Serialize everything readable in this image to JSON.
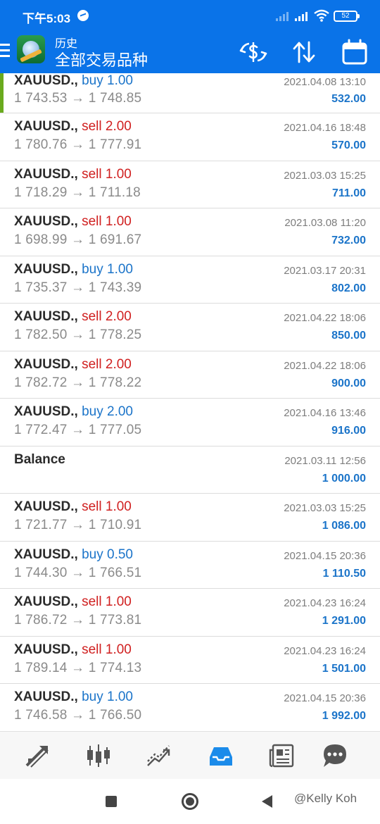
{
  "status_bar": {
    "time": "下午5:03",
    "battery": "52"
  },
  "app_bar": {
    "title_small": "历史",
    "title_large": "全部交易品种",
    "accent_color": "#0a73e8",
    "icons": [
      "menu-icon",
      "app-logo-icon",
      "currency-swap-icon",
      "sort-icon",
      "calendar-icon"
    ]
  },
  "trades": [
    {
      "symbol": "XAUUSD.,",
      "side": "buy",
      "volume": "1.00",
      "open": "1 743.53",
      "close": "1 748.85",
      "date": "2021.04.08 13:10",
      "amount": "532.00"
    },
    {
      "symbol": "XAUUSD.,",
      "side": "sell",
      "volume": "2.00",
      "open": "1 780.76",
      "close": "1 777.91",
      "date": "2021.04.16 18:48",
      "amount": "570.00"
    },
    {
      "symbol": "XAUUSD.,",
      "side": "sell",
      "volume": "1.00",
      "open": "1 718.29",
      "close": "1 711.18",
      "date": "2021.03.03 15:25",
      "amount": "711.00"
    },
    {
      "symbol": "XAUUSD.,",
      "side": "sell",
      "volume": "1.00",
      "open": "1 698.99",
      "close": "1 691.67",
      "date": "2021.03.08 11:20",
      "amount": "732.00"
    },
    {
      "symbol": "XAUUSD.,",
      "side": "buy",
      "volume": "1.00",
      "open": "1 735.37",
      "close": "1 743.39",
      "date": "2021.03.17 20:31",
      "amount": "802.00"
    },
    {
      "symbol": "XAUUSD.,",
      "side": "sell",
      "volume": "2.00",
      "open": "1 782.50",
      "close": "1 778.25",
      "date": "2021.04.22 18:06",
      "amount": "850.00"
    },
    {
      "symbol": "XAUUSD.,",
      "side": "sell",
      "volume": "2.00",
      "open": "1 782.72",
      "close": "1 778.22",
      "date": "2021.04.22 18:06",
      "amount": "900.00"
    },
    {
      "symbol": "XAUUSD.,",
      "side": "buy",
      "volume": "2.00",
      "open": "1 772.47",
      "close": "1 777.05",
      "date": "2021.04.16 13:46",
      "amount": "916.00"
    },
    {
      "symbol": "Balance",
      "side": "",
      "volume": "",
      "open": "",
      "close": "",
      "date": "2021.03.11 12:56",
      "amount": "1 000.00"
    },
    {
      "symbol": "XAUUSD.,",
      "side": "sell",
      "volume": "1.00",
      "open": "1 721.77",
      "close": "1 710.91",
      "date": "2021.03.03 15:25",
      "amount": "1 086.00"
    },
    {
      "symbol": "XAUUSD.,",
      "side": "buy",
      "volume": "0.50",
      "open": "1 744.30",
      "close": "1 766.51",
      "date": "2021.04.15 20:36",
      "amount": "1 110.50"
    },
    {
      "symbol": "XAUUSD.,",
      "side": "sell",
      "volume": "1.00",
      "open": "1 786.72",
      "close": "1 773.81",
      "date": "2021.04.23 16:24",
      "amount": "1 291.00"
    },
    {
      "symbol": "XAUUSD.,",
      "side": "sell",
      "volume": "1.00",
      "open": "1 789.14",
      "close": "1 774.13",
      "date": "2021.04.23 16:24",
      "amount": "1 501.00"
    },
    {
      "symbol": "XAUUSD.,",
      "side": "buy",
      "volume": "1.00",
      "open": "1 746.58",
      "close": "1 766.50",
      "date": "2021.04.15 20:36",
      "amount": "1 992.00"
    }
  ],
  "colors": {
    "buy": "#1b74c9",
    "sell": "#d02020",
    "amount": "#1b74c9",
    "selected_marker": "#6aaa1e"
  },
  "bottom_nav": {
    "items": [
      "quotes-icon",
      "chart-icon",
      "trade-icon",
      "history-icon",
      "news-icon",
      "chat-icon"
    ],
    "active": "history-icon"
  },
  "watermark": "@Kelly Koh"
}
